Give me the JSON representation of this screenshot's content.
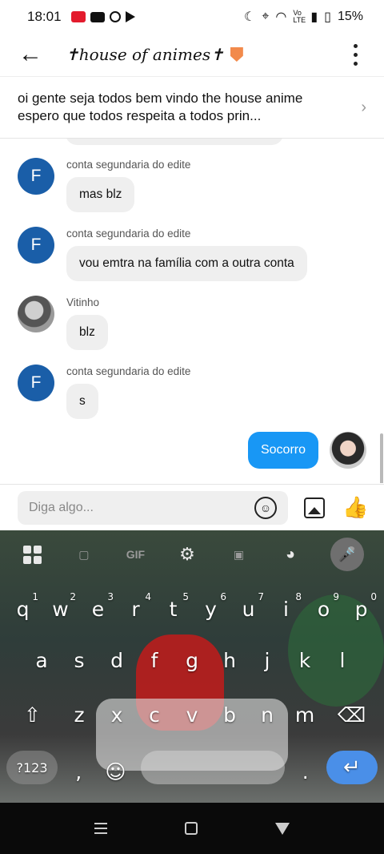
{
  "status_bar": {
    "time": "18:01",
    "battery": "15%",
    "network": "Vo LTE",
    "icons": [
      "screen-record-icon",
      "youtube-icon",
      "chrome-icon",
      "play-store-icon",
      "moon-icon",
      "location-icon",
      "wifi-icon",
      "signal-icon",
      "battery-icon"
    ]
  },
  "header": {
    "title": "✝house of animes✝",
    "back_icon": "arrow-left-icon",
    "more_icon": "vertical-dots-icon"
  },
  "pinned": {
    "text": "oi gente seja todos bem vindo the house anime espero que todos respeita a todos prin..."
  },
  "messages": [
    {
      "avatar": "F",
      "sender": "conta segundaria do edite",
      "text": "mas blz"
    },
    {
      "avatar": "F",
      "sender": "conta segundaria do edite",
      "text": "vou emtra na família com a outra conta"
    },
    {
      "avatar": "",
      "sender": "Vitinho",
      "text": "blz"
    },
    {
      "avatar": "F",
      "sender": "conta segundaria do edite",
      "text": "s"
    }
  ],
  "outgoing": {
    "text": "Socorro"
  },
  "composer": {
    "placeholder": "Diga algo..."
  },
  "keyboard": {
    "toolbar": {
      "gif": "GIF"
    },
    "row1": [
      {
        "k": "q",
        "n": "1"
      },
      {
        "k": "w",
        "n": "2"
      },
      {
        "k": "e",
        "n": "3"
      },
      {
        "k": "r",
        "n": "4"
      },
      {
        "k": "t",
        "n": "5"
      },
      {
        "k": "y",
        "n": "6"
      },
      {
        "k": "u",
        "n": "7"
      },
      {
        "k": "i",
        "n": "8"
      },
      {
        "k": "o",
        "n": "9"
      },
      {
        "k": "p",
        "n": "0"
      }
    ],
    "row2": [
      "a",
      "s",
      "d",
      "f",
      "g",
      "h",
      "j",
      "k",
      "l"
    ],
    "row3": [
      "z",
      "x",
      "c",
      "v",
      "b",
      "n",
      "m"
    ],
    "symbols_label": "?123",
    "comma": ",",
    "period": "."
  },
  "colors": {
    "accent": "#1897f5",
    "avatar_blue": "#1a5ea8",
    "bubble_gray": "#efefef"
  }
}
